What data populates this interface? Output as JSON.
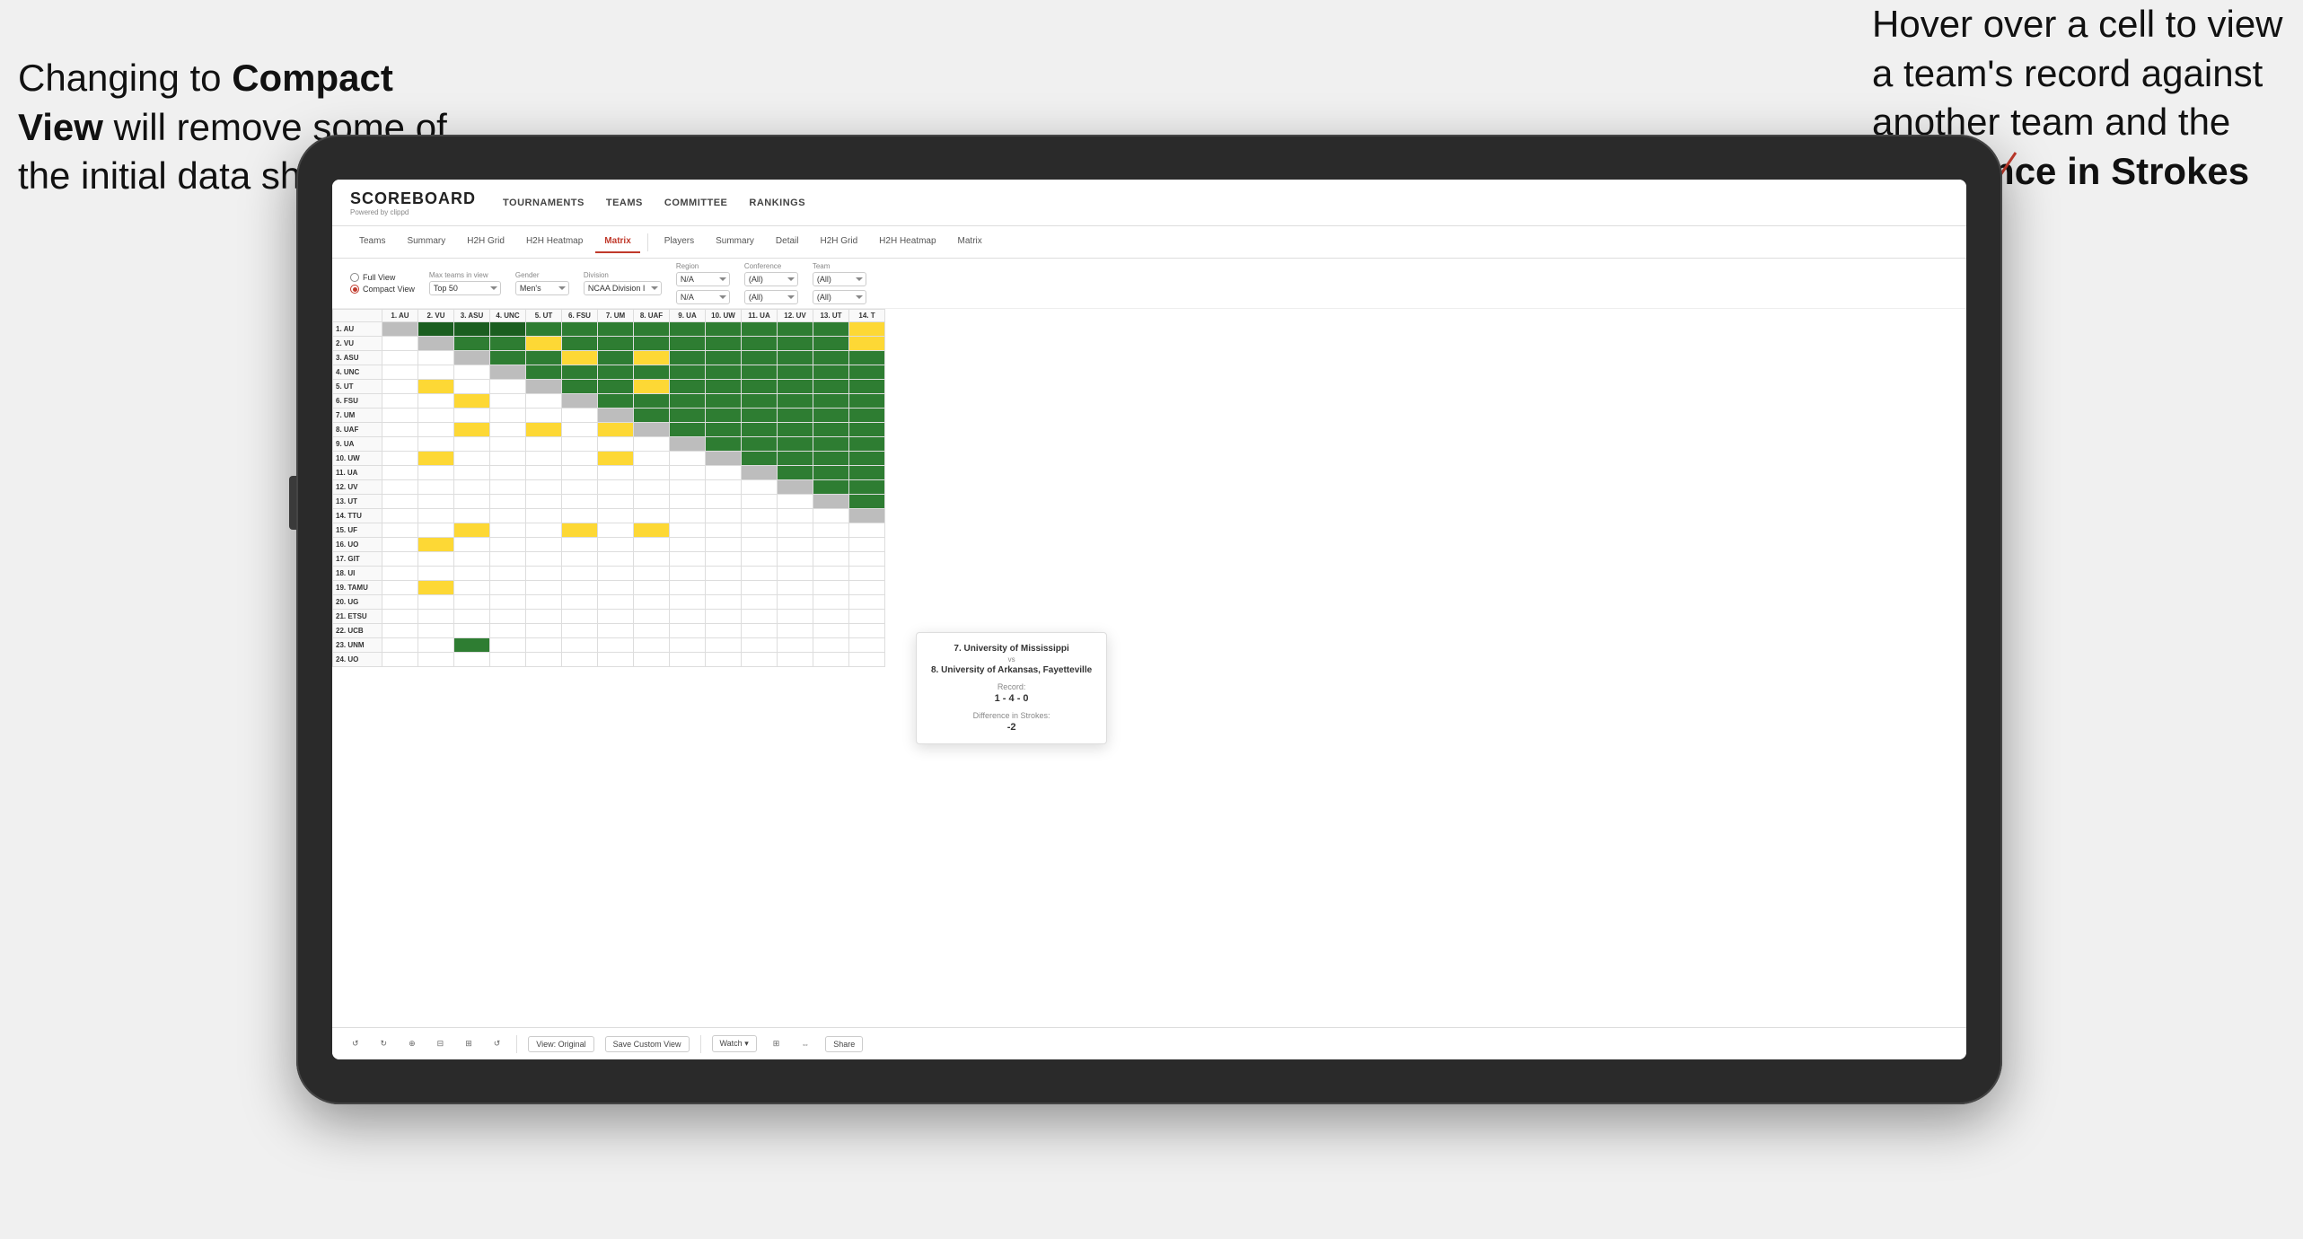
{
  "annotations": {
    "left_text": "Changing to Compact View will remove some of the initial data shown",
    "left_bold": "Compact View",
    "right_text": "Hover over a cell to view a team's record against another team and the Difference in Strokes",
    "right_bold": "Difference in Strokes"
  },
  "app": {
    "logo": "SCOREBOARD",
    "logo_sub": "Powered by clippd",
    "nav": [
      "TOURNAMENTS",
      "TEAMS",
      "COMMITTEE",
      "RANKINGS"
    ]
  },
  "sub_nav": {
    "group1": [
      "Teams",
      "Summary",
      "H2H Grid",
      "H2H Heatmap",
      "Matrix"
    ],
    "group2": [
      "Players",
      "Summary",
      "Detail",
      "H2H Grid",
      "H2H Heatmap",
      "Matrix"
    ],
    "active": "Matrix"
  },
  "filters": {
    "view_options": [
      "Full View",
      "Compact View"
    ],
    "selected_view": "Compact View",
    "max_teams_label": "Max teams in view",
    "max_teams_value": "Top 50",
    "gender_label": "Gender",
    "gender_value": "Men's",
    "division_label": "Division",
    "division_value": "NCAA Division I",
    "region_label": "Region",
    "region_values": [
      "N/A",
      "N/A"
    ],
    "conference_label": "Conference",
    "conference_values": [
      "(All)",
      "(All)"
    ],
    "team_label": "Team",
    "team_values": [
      "(All)",
      "(All)"
    ]
  },
  "matrix": {
    "col_headers": [
      "1. AU",
      "2. VU",
      "3. ASU",
      "4. UNC",
      "5. UT",
      "6. FSU",
      "7. UM",
      "8. UAF",
      "9. UA",
      "10. UW",
      "11. UA",
      "12. UV",
      "13. UT",
      "14. T"
    ],
    "rows": [
      {
        "label": "1. AU",
        "cells": [
          "x",
          "g",
          "g",
          "g",
          "g",
          "g",
          "g",
          "g",
          "g",
          "g",
          "g",
          "g",
          "g",
          "g"
        ]
      },
      {
        "label": "2. VU",
        "cells": [
          "w",
          "x",
          "g",
          "g",
          "y",
          "g",
          "g",
          "g",
          "g",
          "g",
          "g",
          "g",
          "g",
          "g"
        ]
      },
      {
        "label": "3. ASU",
        "cells": [
          "w",
          "w",
          "x",
          "g",
          "g",
          "y",
          "g",
          "y",
          "g",
          "g",
          "g",
          "g",
          "g",
          "g"
        ]
      },
      {
        "label": "4. UNC",
        "cells": [
          "w",
          "w",
          "w",
          "x",
          "g",
          "g",
          "g",
          "g",
          "g",
          "g",
          "g",
          "g",
          "g",
          "g"
        ]
      },
      {
        "label": "5. UT",
        "cells": [
          "w",
          "y",
          "w",
          "w",
          "x",
          "g",
          "g",
          "y",
          "g",
          "g",
          "g",
          "g",
          "g",
          "g"
        ]
      },
      {
        "label": "6. FSU",
        "cells": [
          "w",
          "w",
          "y",
          "w",
          "w",
          "x",
          "g",
          "g",
          "g",
          "g",
          "g",
          "g",
          "g",
          "g"
        ]
      },
      {
        "label": "7. UM",
        "cells": [
          "w",
          "w",
          "w",
          "w",
          "w",
          "w",
          "x",
          "g",
          "g",
          "g",
          "g",
          "g",
          "g",
          "g"
        ]
      },
      {
        "label": "8. UAF",
        "cells": [
          "w",
          "w",
          "y",
          "w",
          "y",
          "w",
          "y",
          "x",
          "g",
          "g",
          "g",
          "g",
          "g",
          "g"
        ]
      },
      {
        "label": "9. UA",
        "cells": [
          "w",
          "w",
          "w",
          "w",
          "w",
          "w",
          "w",
          "w",
          "x",
          "g",
          "g",
          "g",
          "g",
          "g"
        ]
      },
      {
        "label": "10. UW",
        "cells": [
          "w",
          "y",
          "w",
          "w",
          "w",
          "w",
          "y",
          "w",
          "w",
          "x",
          "g",
          "g",
          "g",
          "g"
        ]
      },
      {
        "label": "11. UA",
        "cells": [
          "w",
          "w",
          "w",
          "w",
          "w",
          "w",
          "w",
          "w",
          "w",
          "w",
          "x",
          "g",
          "g",
          "g"
        ]
      },
      {
        "label": "12. UV",
        "cells": [
          "w",
          "w",
          "w",
          "w",
          "w",
          "w",
          "w",
          "w",
          "w",
          "w",
          "w",
          "x",
          "g",
          "g"
        ]
      },
      {
        "label": "13. UT",
        "cells": [
          "w",
          "w",
          "w",
          "w",
          "w",
          "w",
          "w",
          "w",
          "w",
          "w",
          "w",
          "w",
          "x",
          "g"
        ]
      },
      {
        "label": "14. TTU",
        "cells": [
          "w",
          "w",
          "w",
          "w",
          "w",
          "w",
          "w",
          "w",
          "w",
          "w",
          "w",
          "w",
          "w",
          "x"
        ]
      },
      {
        "label": "15. UF",
        "cells": [
          "w",
          "w",
          "y",
          "w",
          "w",
          "y",
          "w",
          "y",
          "w",
          "w",
          "w",
          "w",
          "w",
          "w"
        ]
      },
      {
        "label": "16. UO",
        "cells": [
          "w",
          "y",
          "w",
          "w",
          "w",
          "w",
          "w",
          "w",
          "w",
          "w",
          "w",
          "w",
          "w",
          "w"
        ]
      },
      {
        "label": "17. GIT",
        "cells": [
          "w",
          "w",
          "w",
          "w",
          "w",
          "w",
          "w",
          "w",
          "w",
          "w",
          "w",
          "w",
          "w",
          "w"
        ]
      },
      {
        "label": "18. UI",
        "cells": [
          "w",
          "w",
          "w",
          "w",
          "w",
          "w",
          "w",
          "w",
          "w",
          "w",
          "w",
          "w",
          "w",
          "w"
        ]
      },
      {
        "label": "19. TAMU",
        "cells": [
          "w",
          "y",
          "w",
          "w",
          "w",
          "w",
          "w",
          "w",
          "w",
          "w",
          "w",
          "w",
          "w",
          "w"
        ]
      },
      {
        "label": "20. UG",
        "cells": [
          "w",
          "w",
          "w",
          "w",
          "w",
          "w",
          "w",
          "w",
          "w",
          "w",
          "w",
          "w",
          "w",
          "w"
        ]
      },
      {
        "label": "21. ETSU",
        "cells": [
          "w",
          "w",
          "w",
          "w",
          "w",
          "w",
          "w",
          "w",
          "w",
          "w",
          "w",
          "w",
          "w",
          "w"
        ]
      },
      {
        "label": "22. UCB",
        "cells": [
          "w",
          "w",
          "w",
          "w",
          "w",
          "w",
          "w",
          "w",
          "w",
          "w",
          "w",
          "w",
          "w",
          "w"
        ]
      },
      {
        "label": "23. UNM",
        "cells": [
          "w",
          "w",
          "w",
          "w",
          "w",
          "w",
          "w",
          "w",
          "w",
          "w",
          "w",
          "w",
          "w",
          "w"
        ]
      },
      {
        "label": "24. UO",
        "cells": [
          "w",
          "w",
          "w",
          "w",
          "w",
          "w",
          "w",
          "w",
          "w",
          "w",
          "w",
          "w",
          "w",
          "w"
        ]
      }
    ]
  },
  "tooltip": {
    "team1": "7. University of Mississippi",
    "vs": "vs",
    "team2": "8. University of Arkansas, Fayetteville",
    "record_label": "Record:",
    "record": "1 - 4 - 0",
    "strokes_label": "Difference in Strokes:",
    "strokes": "-2"
  },
  "toolbar": {
    "buttons": [
      "↺",
      "↻",
      "⊕",
      "⊟",
      "⊞",
      "↺"
    ],
    "view_original": "View: Original",
    "save_custom": "Save Custom View",
    "watch": "Watch ▾",
    "share": "Share"
  }
}
